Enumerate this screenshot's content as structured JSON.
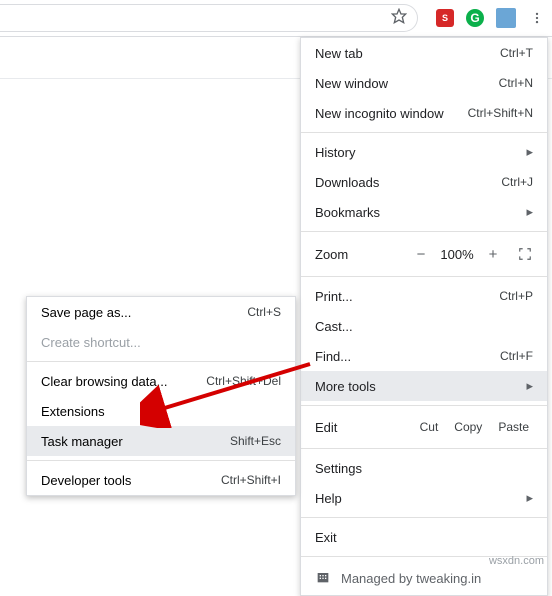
{
  "toolbar": {
    "ext_s": "S",
    "ext_g": "G"
  },
  "menu": {
    "new_tab": "New tab",
    "new_tab_sc": "Ctrl+T",
    "new_window": "New window",
    "new_window_sc": "Ctrl+N",
    "incognito": "New incognito window",
    "incognito_sc": "Ctrl+Shift+N",
    "history": "History",
    "downloads": "Downloads",
    "downloads_sc": "Ctrl+J",
    "bookmarks": "Bookmarks",
    "zoom": "Zoom",
    "zoom_minus": "−",
    "zoom_val": "100%",
    "zoom_plus": "+",
    "print": "Print...",
    "print_sc": "Ctrl+P",
    "cast": "Cast...",
    "find": "Find...",
    "find_sc": "Ctrl+F",
    "more_tools": "More tools",
    "edit": "Edit",
    "cut": "Cut",
    "copy": "Copy",
    "paste": "Paste",
    "settings": "Settings",
    "help": "Help",
    "exit": "Exit",
    "managed": "Managed by tweaking.in"
  },
  "submenu": {
    "save_page": "Save page as...",
    "save_page_sc": "Ctrl+S",
    "create_shortcut": "Create shortcut...",
    "clear_data": "Clear browsing data...",
    "clear_data_sc": "Ctrl+Shift+Del",
    "extensions": "Extensions",
    "task_manager": "Task manager",
    "task_manager_sc": "Shift+Esc",
    "dev_tools": "Developer tools",
    "dev_tools_sc": "Ctrl+Shift+I"
  },
  "watermark": "wsxdn.com"
}
